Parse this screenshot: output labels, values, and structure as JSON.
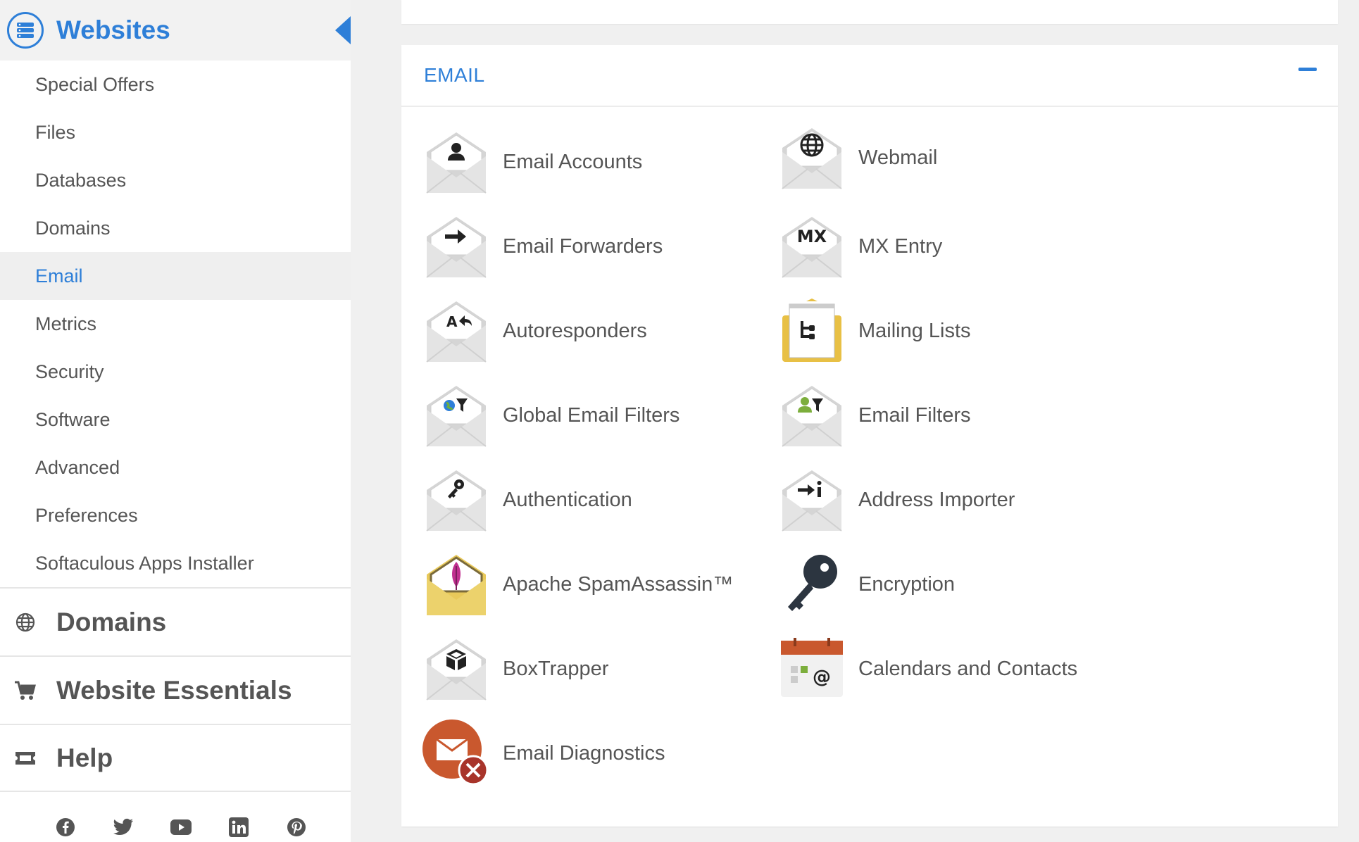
{
  "sidebar": {
    "title": "Websites",
    "items": [
      {
        "label": "Special Offers",
        "active": false
      },
      {
        "label": "Files",
        "active": false
      },
      {
        "label": "Databases",
        "active": false
      },
      {
        "label": "Domains",
        "active": false
      },
      {
        "label": "Email",
        "active": true
      },
      {
        "label": "Metrics",
        "active": false
      },
      {
        "label": "Security",
        "active": false
      },
      {
        "label": "Software",
        "active": false
      },
      {
        "label": "Advanced",
        "active": false
      },
      {
        "label": "Preferences",
        "active": false
      },
      {
        "label": "Softaculous Apps Installer",
        "active": false
      }
    ],
    "sections": [
      {
        "label": "Domains",
        "icon": "globe-icon"
      },
      {
        "label": "Website Essentials",
        "icon": "cart-icon"
      },
      {
        "label": "Help",
        "icon": "ticket-icon"
      }
    ],
    "social": [
      "facebook-icon",
      "twitter-icon",
      "youtube-icon",
      "linkedin-icon",
      "pinterest-icon"
    ]
  },
  "email_panel": {
    "title": "EMAIL",
    "left_items": [
      {
        "label": "Email Accounts",
        "icon": "email-accounts-icon"
      },
      {
        "label": "Email Forwarders",
        "icon": "email-forwarders-icon"
      },
      {
        "label": "Autoresponders",
        "icon": "autoresponders-icon"
      },
      {
        "label": "Global Email Filters",
        "icon": "global-email-filters-icon"
      },
      {
        "label": "Authentication",
        "icon": "authentication-icon"
      },
      {
        "label": "Apache SpamAssassin™",
        "icon": "spamassassin-icon"
      },
      {
        "label": "BoxTrapper",
        "icon": "boxtrapper-icon"
      },
      {
        "label": "Email Diagnostics",
        "icon": "email-diagnostics-icon"
      }
    ],
    "right_items": [
      {
        "label": "Webmail",
        "icon": "webmail-icon"
      },
      {
        "label": "MX Entry",
        "icon": "mx-entry-icon"
      },
      {
        "label": "Mailing Lists",
        "icon": "mailing-lists-icon"
      },
      {
        "label": "Email Filters",
        "icon": "email-filters-icon"
      },
      {
        "label": "Address Importer",
        "icon": "address-importer-icon"
      },
      {
        "label": "Encryption",
        "icon": "encryption-icon"
      },
      {
        "label": "Calendars and Contacts",
        "icon": "calendars-contacts-icon"
      }
    ],
    "mx_text": "MX"
  },
  "colors": {
    "accent": "#2e7fd8",
    "text": "#555555",
    "envelope": "#e3e3e3",
    "spam_yellow": "#e8c95a"
  }
}
